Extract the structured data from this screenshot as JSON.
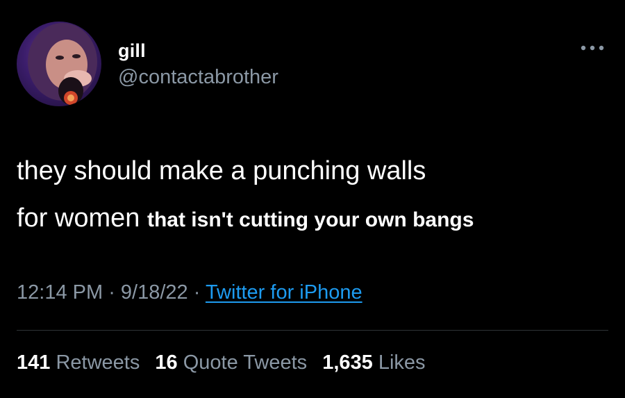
{
  "user": {
    "display_name": "gill",
    "handle": "@contactabrother",
    "avatar_icon": "user-avatar-photo"
  },
  "more_icon": "more-horizontal-icon",
  "tweet": {
    "line1": "they should make a punching walls",
    "line2_regular": "for women",
    "line2_bold": "that isn't cutting your own bangs"
  },
  "meta": {
    "time": "12:14 PM",
    "separator1": " · ",
    "date": "9/18/22",
    "separator2": " · ",
    "source": "Twitter for iPhone"
  },
  "stats": {
    "retweets_count": "141",
    "retweets_label": "Retweets",
    "quotes_count": "16",
    "quotes_label": "Quote Tweets",
    "likes_count": "1,635",
    "likes_label": "Likes"
  },
  "colors": {
    "background": "#000000",
    "primary_text": "#ffffff",
    "secondary_text": "#8b98a5",
    "link": "#1d9bf0",
    "divider": "#2f3336"
  }
}
